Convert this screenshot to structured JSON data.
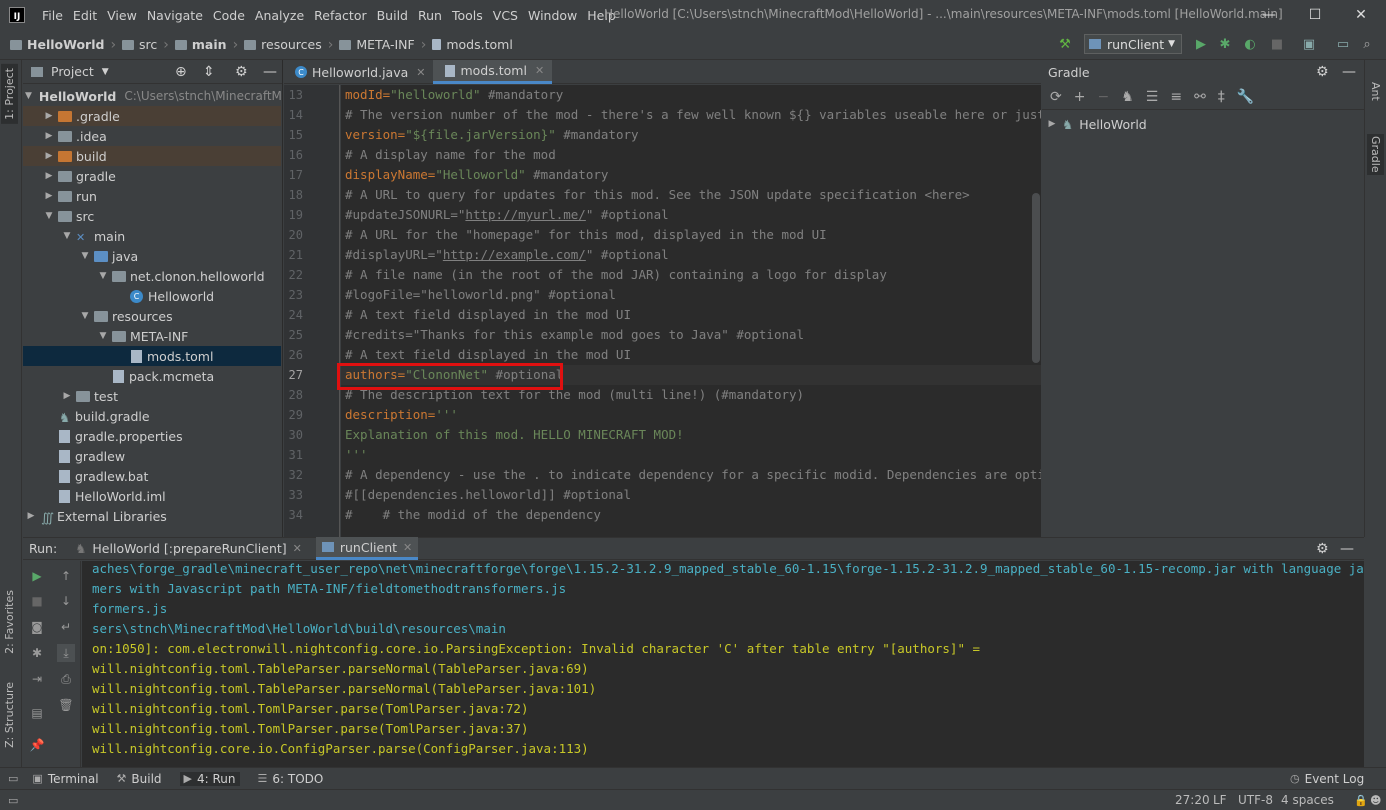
{
  "menu": [
    "File",
    "Edit",
    "View",
    "Navigate",
    "Code",
    "Analyze",
    "Refactor",
    "Build",
    "Run",
    "Tools",
    "VCS",
    "Window",
    "Help"
  ],
  "window_title": "HelloWorld [C:\\Users\\stnch\\MinecraftMod\\HelloWorld] - ...\\main\\resources\\META-INF\\mods.toml [HelloWorld.main]",
  "breadcrumbs": [
    "HelloWorld",
    "src",
    "main",
    "resources",
    "META-INF",
    "mods.toml"
  ],
  "run_config": "runClient",
  "left_stripe": {
    "project": "1: Project",
    "favorites": "2: Favorites",
    "structure": "Z: Structure"
  },
  "right_stripe": {
    "ant": "Ant",
    "gradle": "Gradle"
  },
  "project_panel": {
    "title": "Project",
    "root_path": "C:\\Users\\stnch\\MinecraftMo",
    "tree": [
      {
        "label": "HelloWorld",
        "arrow": "▼"
      },
      {
        "label": ".gradle",
        "arrow": "▶"
      },
      {
        "label": ".idea",
        "arrow": "▶"
      },
      {
        "label": "build",
        "arrow": "▶"
      },
      {
        "label": "gradle",
        "arrow": "▶"
      },
      {
        "label": "run",
        "arrow": "▶"
      },
      {
        "label": "src",
        "arrow": "▼"
      },
      {
        "label": "main",
        "arrow": "▼"
      },
      {
        "label": "java",
        "arrow": "▼"
      },
      {
        "label": "net.clonon.helloworld",
        "arrow": "▼"
      },
      {
        "label": "Helloworld",
        "arrow": ""
      },
      {
        "label": "resources",
        "arrow": "▼"
      },
      {
        "label": "META-INF",
        "arrow": "▼"
      },
      {
        "label": "mods.toml",
        "arrow": ""
      },
      {
        "label": "pack.mcmeta",
        "arrow": ""
      },
      {
        "label": "test",
        "arrow": "▶"
      },
      {
        "label": "build.gradle",
        "arrow": ""
      },
      {
        "label": "gradle.properties",
        "arrow": ""
      },
      {
        "label": "gradlew",
        "arrow": ""
      },
      {
        "label": "gradlew.bat",
        "arrow": ""
      },
      {
        "label": "HelloWorld.iml",
        "arrow": ""
      },
      {
        "label": "External Libraries",
        "arrow": "▶"
      }
    ]
  },
  "editor": {
    "tabs": [
      {
        "label": "Helloworld.java",
        "active": false
      },
      {
        "label": "mods.toml",
        "active": true
      }
    ],
    "line_numbers": [
      "13",
      "14",
      "15",
      "16",
      "17",
      "18",
      "19",
      "20",
      "21",
      "22",
      "23",
      "24",
      "25",
      "26",
      "27",
      "28",
      "29",
      "30",
      "31",
      "32",
      "33",
      "34"
    ],
    "lines": [
      {
        "a": "modId=",
        "b": "\"helloworld\"",
        "c": " #mandatory",
        "type": "kv"
      },
      {
        "text": "# The version number of the mod - there's a few well known ${} variables useable here or just hardcode",
        "type": "comment"
      },
      {
        "a": "version=",
        "b": "\"${file.jarVersion}\"",
        "c": " #mandatory",
        "type": "kv"
      },
      {
        "text": "# A display name for the mod",
        "type": "comment"
      },
      {
        "a": "displayName=",
        "b": "\"Helloworld\"",
        "c": " #mandatory",
        "type": "kv"
      },
      {
        "text": "# A URL to query for updates for this mod. See the JSON update specification <here>",
        "type": "comment"
      },
      {
        "a": "#updateJSONURL=\"",
        "u": "http://myurl.me/",
        "c": "\" #optional",
        "type": "url"
      },
      {
        "text": "# A URL for the \"homepage\" for this mod, displayed in the mod UI",
        "type": "comment"
      },
      {
        "a": "#displayURL=\"",
        "u": "http://example.com/",
        "c": "\" #optional",
        "type": "url"
      },
      {
        "text": "# A file name (in the root of the mod JAR) containing a logo for display",
        "type": "comment"
      },
      {
        "text": "#logoFile=\"helloworld.png\" #optional",
        "type": "comment"
      },
      {
        "text": "# A text field displayed in the mod UI",
        "type": "comment"
      },
      {
        "text": "#credits=\"Thanks for this example mod goes to Java\" #optional",
        "type": "comment"
      },
      {
        "text": "# A text field displayed in the mod UI",
        "type": "comment"
      },
      {
        "a": "authors=",
        "b": "\"ClononNet\"",
        "c": " #optional",
        "type": "kv"
      },
      {
        "text": "# The description text for the mod (multi line!) (#mandatory)",
        "type": "comment"
      },
      {
        "a": "description=",
        "b": "'''",
        "c": "",
        "type": "kv"
      },
      {
        "text": "Explanation of this mod. HELLO MINECRAFT MOD!",
        "type": "string"
      },
      {
        "text": "'''",
        "type": "string"
      },
      {
        "text": "# A dependency - use the . to indicate dependency for a specific modid. Dependencies are optional.",
        "type": "comment"
      },
      {
        "text": "#[[dependencies.helloworld]] #optional",
        "type": "comment"
      },
      {
        "text": "#    # the modid of the dependency",
        "type": "comment"
      }
    ]
  },
  "gradle_panel": {
    "title": "Gradle",
    "root": "HelloWorld"
  },
  "run_panel": {
    "label": "Run:",
    "tabs": [
      {
        "label": "HelloWorld [:prepareRunClient]",
        "active": false
      },
      {
        "label": "runClient",
        "active": true
      }
    ],
    "console": [
      {
        "text": "aches\\forge_gradle\\minecraft_user_repo\\net\\minecraftforge\\forge\\1.15.2-31.2.9_mapped_stable_60-1.15\\forge-1.15.2-31.2.9_mapped_stable_60-1.15-recomp.jar with language javafml",
        "type": "link"
      },
      {
        "text": "mers with Javascript path META-INF/fieldtomethodtransformers.js",
        "type": "link"
      },
      {
        "text": "formers.js",
        "type": "link"
      },
      {
        "text": "sers\\stnch\\MinecraftMod\\HelloWorld\\build\\resources\\main",
        "type": "link"
      },
      {
        "text": "on:1050]: com.electronwill.nightconfig.core.io.ParsingException: Invalid character 'C' after table entry \"[authors]\" =",
        "type": "err"
      },
      {
        "text": "will.nightconfig.toml.TableParser.parseNormal(TableParser.java:69)",
        "type": "err"
      },
      {
        "text": "will.nightconfig.toml.TableParser.parseNormal(TableParser.java:101)",
        "type": "err"
      },
      {
        "text": "will.nightconfig.toml.TomlParser.parse(TomlParser.java:72)",
        "type": "err"
      },
      {
        "text": "will.nightconfig.toml.TomlParser.parse(TomlParser.java:37)",
        "type": "err"
      },
      {
        "text": "will.nightconfig.core.io.ConfigParser.parse(ConfigParser.java:113)",
        "type": "err"
      }
    ]
  },
  "bottom_tools": [
    {
      "label": "Terminal",
      "icon": "terminal-icon"
    },
    {
      "label": "Build",
      "icon": "hammer-icon"
    },
    {
      "label": "4: Run",
      "icon": "run-icon"
    },
    {
      "label": "6: TODO",
      "icon": "list-icon"
    }
  ],
  "event_log": "Event Log",
  "status": {
    "position": "27:20",
    "line_sep": "LF",
    "encoding": "UTF-8",
    "indent": "4 spaces"
  },
  "colors": {
    "keyword": "#cc7832",
    "string": "#6a8759",
    "comment": "#808080",
    "highlight_box": "#e01010",
    "console_text": "#c8c828",
    "console_link": "#4ab0c4"
  }
}
